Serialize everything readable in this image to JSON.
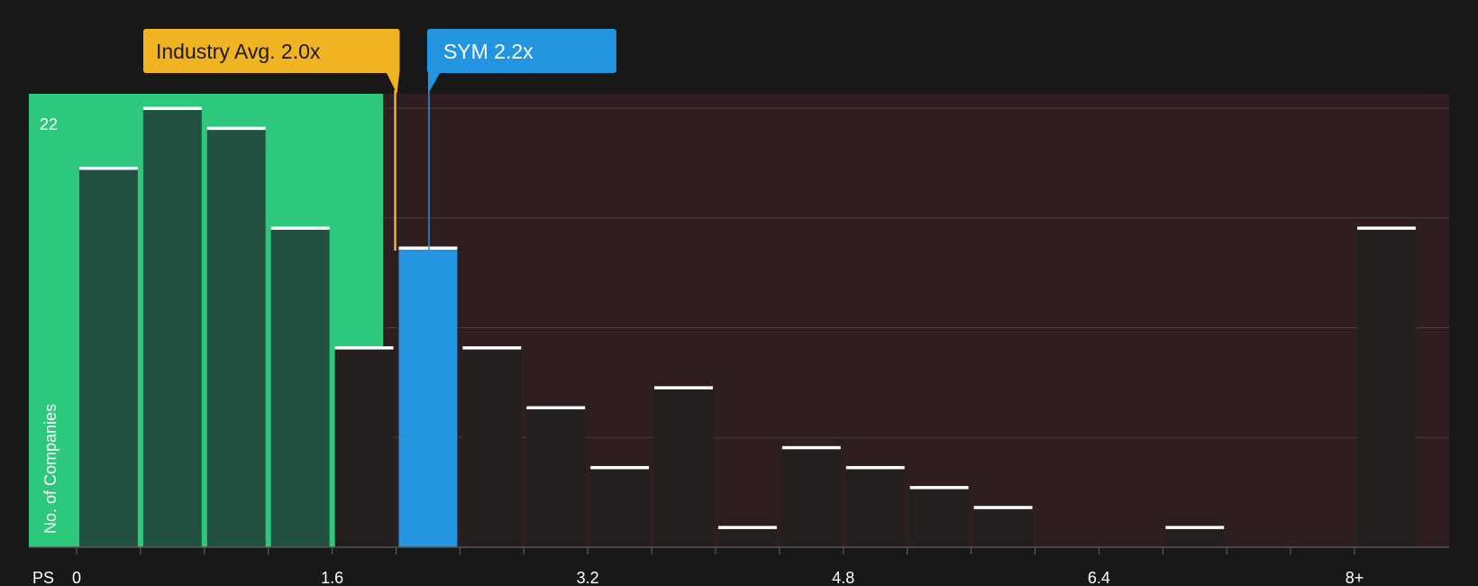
{
  "chart_data": {
    "type": "bar",
    "xlabel": "PS",
    "ylabel": "No. of Companies",
    "y_max_label": "22",
    "ylim": [
      0,
      22
    ],
    "x_ticks": [
      "0",
      "1.6",
      "3.2",
      "4.8",
      "6.4",
      "8+"
    ],
    "bin_width": 0.4,
    "bins": [
      {
        "x": 0.0,
        "count": 19
      },
      {
        "x": 0.4,
        "count": 22
      },
      {
        "x": 0.8,
        "count": 21
      },
      {
        "x": 1.2,
        "count": 16
      },
      {
        "x": 1.6,
        "count": 10
      },
      {
        "x": 2.0,
        "count": 15,
        "highlight": true
      },
      {
        "x": 2.4,
        "count": 10
      },
      {
        "x": 2.8,
        "count": 7
      },
      {
        "x": 3.2,
        "count": 4
      },
      {
        "x": 3.6,
        "count": 8
      },
      {
        "x": 4.0,
        "count": 1
      },
      {
        "x": 4.4,
        "count": 5
      },
      {
        "x": 4.8,
        "count": 4
      },
      {
        "x": 5.2,
        "count": 3
      },
      {
        "x": 5.6,
        "count": 2
      },
      {
        "x": 6.0,
        "count": 0
      },
      {
        "x": 6.4,
        "count": 0
      },
      {
        "x": 6.8,
        "count": 1
      },
      {
        "x": 7.2,
        "count": 0
      },
      {
        "x": 7.6,
        "count": 0
      },
      {
        "x": 8.0,
        "count": 16
      }
    ],
    "industry_avg": {
      "label": "Industry Avg. 2.0x",
      "value": 2.0,
      "color": "#f0b322"
    },
    "company": {
      "label": "SYM 2.2x",
      "value": 2.2,
      "color": "#2394e0"
    },
    "colors": {
      "undervalued_zone": "#2ec87c",
      "overvalued_zone": "#2e1e1f",
      "bar_in_zone": "#22483a",
      "bar_default": "#231f1f",
      "bar_highlight": "#2394e0",
      "bar_cap": "#ffffff"
    },
    "grid": true
  }
}
